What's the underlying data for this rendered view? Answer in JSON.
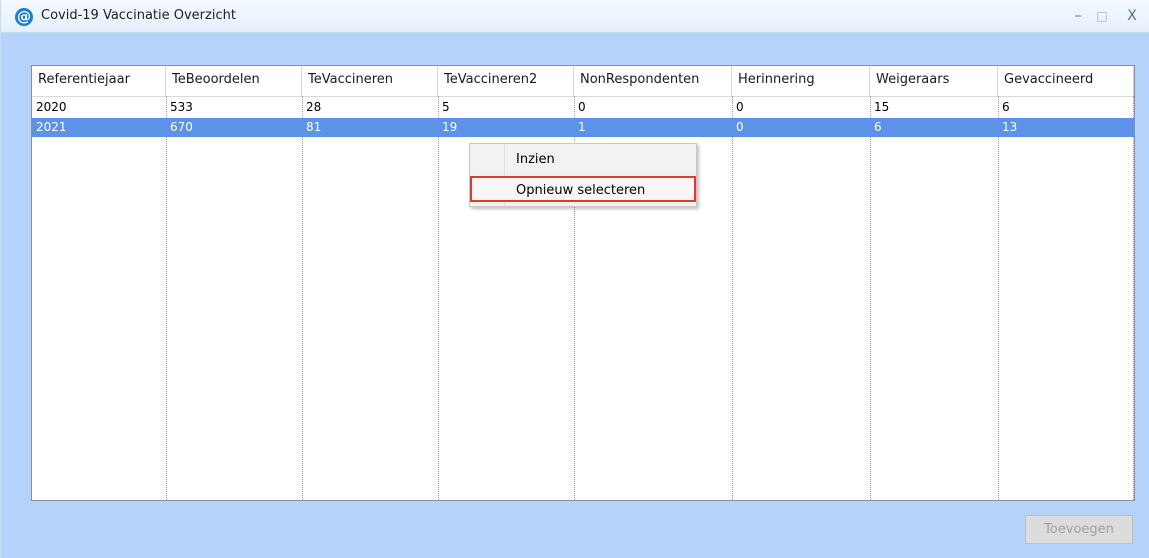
{
  "window": {
    "title": "Covid-19 Vaccinatie Overzicht",
    "app_icon_glyph": "@",
    "controls": {
      "minimize": "–",
      "maximize": "□",
      "close": "X"
    }
  },
  "table": {
    "columns": [
      "Referentiejaar",
      "TeBeoordelen",
      "TeVaccineren",
      "TeVaccineren2",
      "NonRespondenten",
      "Herinnering",
      "Weigeraars",
      "Gevaccineerd"
    ],
    "rows": [
      [
        "2020",
        "533",
        "28",
        "5",
        "0",
        "0",
        "15",
        "6"
      ],
      [
        "2021",
        "670",
        "81",
        "19",
        "1",
        "0",
        "6",
        "13"
      ]
    ],
    "selected_row_index": 1,
    "selection_color": "#5c92e8"
  },
  "context_menu": {
    "items": [
      "Inzien",
      "Opnieuw selecteren"
    ],
    "highlighted_index": 1,
    "highlight_color": "#e0373a"
  },
  "footer": {
    "add_button_label": "Toevoegen",
    "add_button_enabled": false
  }
}
